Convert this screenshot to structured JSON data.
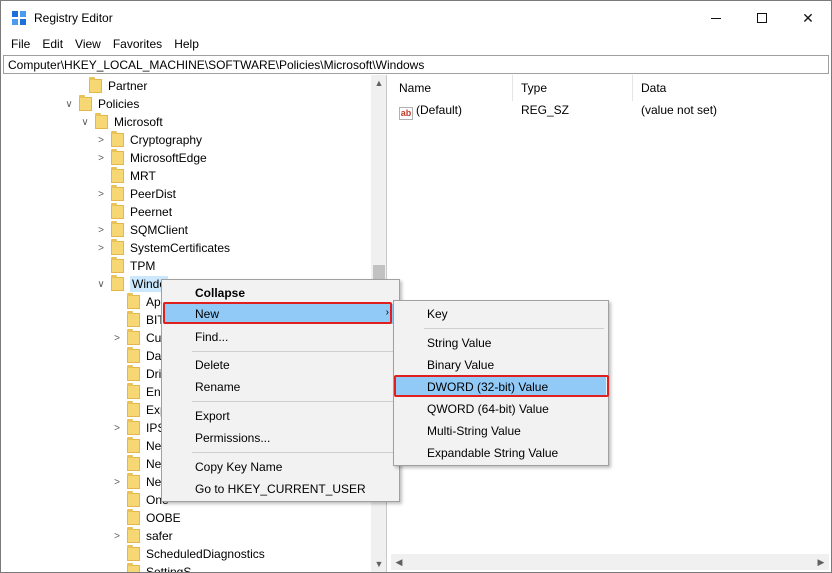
{
  "window": {
    "title": "Registry Editor",
    "minimize": "—",
    "maximize": "☐",
    "close": "✕"
  },
  "menubar": [
    "File",
    "Edit",
    "View",
    "Favorites",
    "Help"
  ],
  "address": "Computer\\HKEY_LOCAL_MACHINE\\SOFTWARE\\Policies\\Microsoft\\Windows",
  "tree": [
    {
      "label": "Partner",
      "chevron": ""
    },
    {
      "label": "Policies",
      "chevron": "∨"
    },
    {
      "label": "Microsoft",
      "chevron": "∨"
    },
    {
      "label": "Cryptography",
      "chevron": ">"
    },
    {
      "label": "MicrosoftEdge",
      "chevron": ">"
    },
    {
      "label": "MRT",
      "chevron": ""
    },
    {
      "label": "PeerDist",
      "chevron": ">"
    },
    {
      "label": "Peernet",
      "chevron": ""
    },
    {
      "label": "SQMClient",
      "chevron": ">"
    },
    {
      "label": "SystemCertificates",
      "chevron": ">"
    },
    {
      "label": "TPM",
      "chevron": ""
    },
    {
      "label": "Windo",
      "chevron": "∨"
    },
    {
      "label": "App",
      "chevron": ""
    },
    {
      "label": "BIT",
      "chevron": ""
    },
    {
      "label": "Cur",
      "chevron": ">"
    },
    {
      "label": "Dat",
      "chevron": ""
    },
    {
      "label": "Driv",
      "chevron": ""
    },
    {
      "label": "Enh",
      "chevron": ""
    },
    {
      "label": "Exp",
      "chevron": ""
    },
    {
      "label": "IPS",
      "chevron": ">"
    },
    {
      "label": "Net",
      "chevron": ""
    },
    {
      "label": "Net",
      "chevron": ""
    },
    {
      "label": "Net",
      "chevron": ">"
    },
    {
      "label": "One",
      "chevron": ""
    },
    {
      "label": "OOBE",
      "chevron": ""
    },
    {
      "label": "safer",
      "chevron": ">"
    },
    {
      "label": "ScheduledDiagnostics",
      "chevron": ""
    },
    {
      "label": "SettingS",
      "chevron": ""
    }
  ],
  "list": {
    "headers": {
      "name": "Name",
      "type": "Type",
      "data": "Data"
    },
    "rows": [
      {
        "icon": "ab",
        "name": "(Default)",
        "type": "REG_SZ",
        "data": "(value not set)"
      }
    ]
  },
  "context_menu": {
    "collapse": "Collapse",
    "new": "New",
    "new_arrow": "›",
    "find": "Find...",
    "delete": "Delete",
    "rename": "Rename",
    "export": "Export",
    "permissions": "Permissions...",
    "copy_key_name": "Copy Key Name",
    "goto_hkcu": "Go to HKEY_CURRENT_USER"
  },
  "submenu": {
    "key": "Key",
    "string_value": "String Value",
    "binary_value": "Binary Value",
    "dword_value": "DWORD (32-bit) Value",
    "qword_value": "QWORD (64-bit) Value",
    "multi_string_value": "Multi-String Value",
    "expandable_string_value": "Expandable String Value"
  },
  "colors": {
    "highlight": "#91c9f7",
    "callout": "#e0201f",
    "folder": "#f7d674"
  }
}
